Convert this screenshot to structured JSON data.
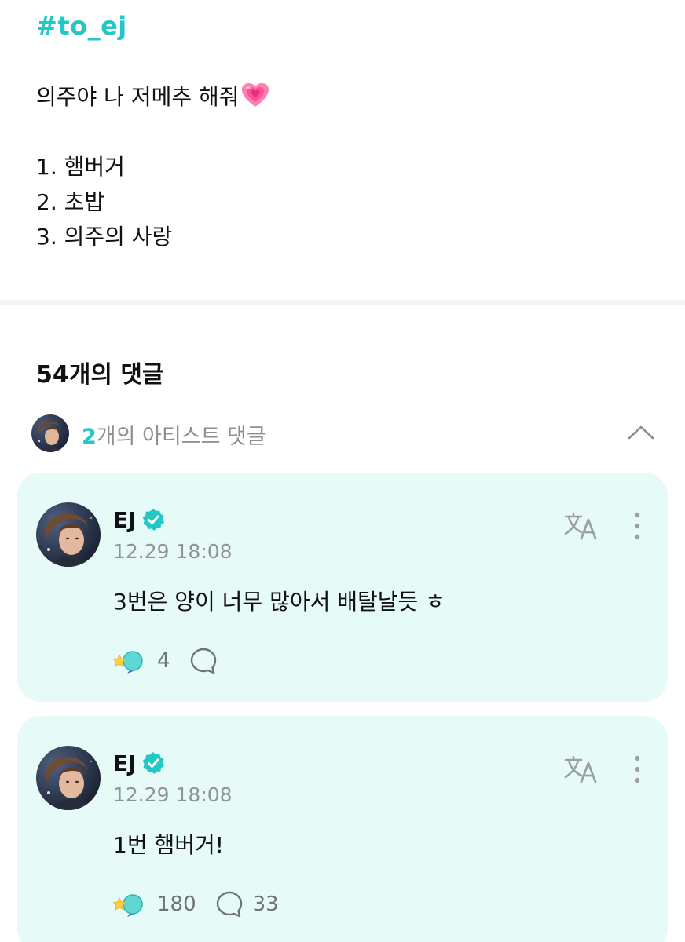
{
  "post": {
    "hashtag": "#to_ej",
    "lines": [
      "의주야 나 저메추 해줘",
      "1. 햄버거",
      "2. 초밥",
      "3. 의주의 사랑"
    ]
  },
  "comments_header": {
    "title": "54개의 댓글"
  },
  "artist_comments": {
    "count": "2",
    "label": "개의 아티스트 댓글"
  },
  "comments": [
    {
      "author": "EJ",
      "time": "12.29 18:08",
      "text": "3번은 양이 너무 많아서 배탈날듯 ㅎ",
      "cheers": "4",
      "replies": ""
    },
    {
      "author": "EJ",
      "time": "12.29 18:08",
      "text": "1번 햄버거!",
      "cheers": "180",
      "replies": "33"
    }
  ],
  "colors": {
    "accent": "#22c9c4",
    "card_background": "#e6faf7",
    "muted_text": "#8f9399"
  },
  "icons": {
    "emoji_heart": "growing-heart-emoji",
    "verified": "verified-badge-icon",
    "translate": "translate-icon",
    "more": "more-vertical-icon",
    "cheer": "cheer-icon",
    "reply": "reply-bubble-icon",
    "collapse": "chevron-up-icon"
  }
}
